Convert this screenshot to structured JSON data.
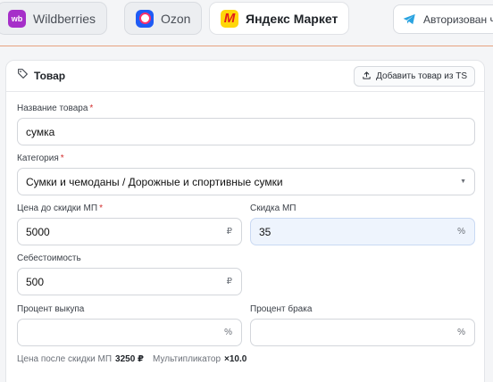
{
  "marketplaces": [
    {
      "name": "Wildberries",
      "logo": "wb",
      "active": false
    },
    {
      "name": "Ozon",
      "logo": "",
      "active": false
    },
    {
      "name": "Яндекс Маркет",
      "logo": "М",
      "active": true
    }
  ],
  "auth": {
    "label": "Авторизован ч",
    "icon": "telegram-icon"
  },
  "card": {
    "title": "Товар",
    "add_button": "Добавить товар из TS"
  },
  "form": {
    "name": {
      "label": "Название товара",
      "value": "сумка"
    },
    "category": {
      "label": "Категория",
      "value": "Сумки и чемоданы / Дорожные и спортивные сумки"
    },
    "price": {
      "label": "Цена до скидки МП",
      "value": "5000",
      "suffix": "₽"
    },
    "discount": {
      "label": "Скидка МП",
      "value": "35",
      "suffix": "%"
    },
    "cost": {
      "label": "Себестоимость",
      "value": "500",
      "suffix": "₽"
    },
    "buyout": {
      "label": "Процент выкупа",
      "value": "",
      "suffix": "%"
    },
    "defect": {
      "label": "Процент брака",
      "value": "",
      "suffix": "%"
    },
    "required_mark": "*"
  },
  "summary": {
    "price_after_label": "Цена после скидки МП",
    "price_after_value": "3250 ₽",
    "multiplier_label": "Мультипликатор",
    "multiplier_value": "×10.0"
  },
  "colors": {
    "accent_line": "#e8a27f",
    "required": "#d32f2f",
    "highlight_field": "#eef4fd"
  }
}
